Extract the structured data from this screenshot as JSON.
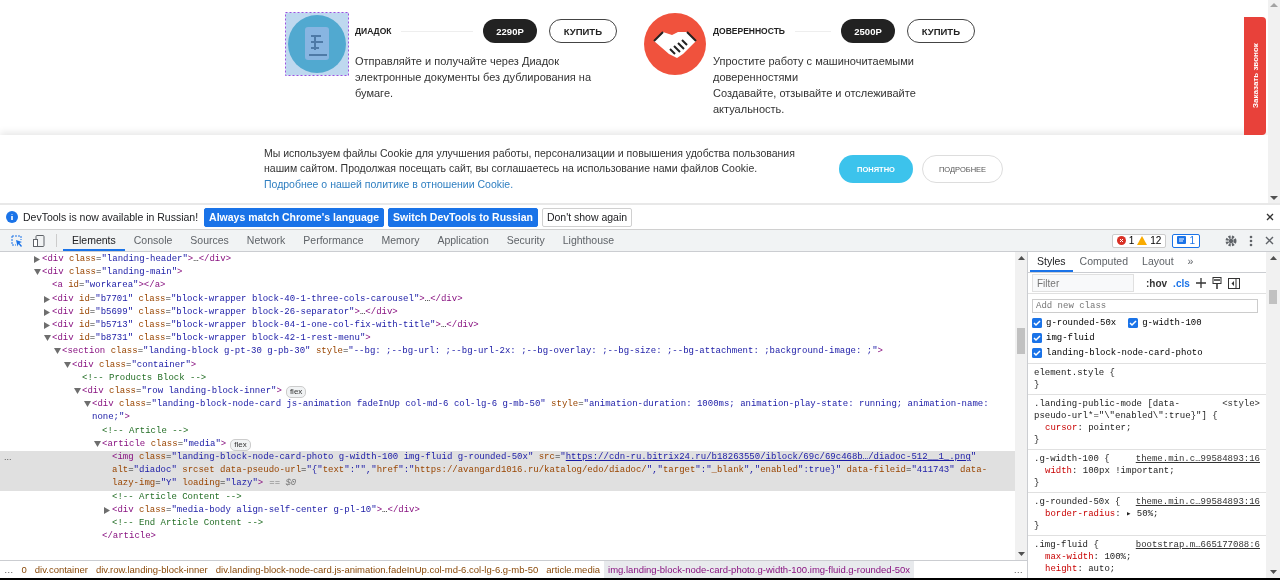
{
  "site": {
    "products": [
      {
        "kind": "document",
        "highlighted": true,
        "title": "ДИАДОК",
        "price": "2290Р",
        "buy_button": "КУПИТЬ",
        "description": [
          "Отправляйте и получайте через Диадок электронные документы без дублирования на бумаге."
        ]
      },
      {
        "kind": "handshake",
        "highlighted": false,
        "title": "ДОВЕРЕННОСТЬ",
        "price": "2500Р",
        "buy_button": "КУПИТЬ",
        "description": [
          "Упростите работу с машиночитаемыми доверенностями",
          "Создавайте, отзывайте и отслеживайте актуальность."
        ]
      }
    ],
    "callback_tab": "Заказать звонок",
    "cookie_banner": {
      "text": "Мы используем файлы Cookie для улучшения работы, персонализации и повышения удобства пользования нашим сайтом. Продолжая посещать сайт, вы соглашаетесь на использование нами файлов Cookie.",
      "link": "Подробнее о нашей политике в отношении Cookie.",
      "accept_button": "ПОНЯТНО",
      "more_button": "ПОДРОБНЕЕ"
    }
  },
  "devtools": {
    "infobar": {
      "message": "DevTools is now available in Russian!",
      "buttons": [
        {
          "label": "Always match Chrome's language",
          "kind": "primary"
        },
        {
          "label": "Switch DevTools to Russian",
          "kind": "primary"
        },
        {
          "label": "Don't show again",
          "kind": "secondary"
        }
      ]
    },
    "tabs": [
      {
        "label": "Elements",
        "selected": true
      },
      {
        "label": "Console",
        "selected": false
      },
      {
        "label": "Sources",
        "selected": false
      },
      {
        "label": "Network",
        "selected": false
      },
      {
        "label": "Performance",
        "selected": false
      },
      {
        "label": "Memory",
        "selected": false
      },
      {
        "label": "Application",
        "selected": false
      },
      {
        "label": "Security",
        "selected": false
      },
      {
        "label": "Lighthouse",
        "selected": false
      }
    ],
    "issues": {
      "errors": "1",
      "warnings": "12",
      "messages": "1"
    },
    "dom_tree": [
      {
        "kind": "element",
        "text": "<div class=\"landing-header\">…</div>",
        "expanded": false,
        "selected": false
      },
      {
        "kind": "element",
        "text": "<div class=\"landing-main\">",
        "expanded": true,
        "selected": false,
        "children": [
          {
            "kind": "leaf",
            "text": "<a id=\"workarea\"></a>",
            "selected": false
          },
          {
            "kind": "element",
            "text": "<div id=\"b7701\" class=\"block-wrapper block-40-1-three-cols-carousel\">…</div>",
            "expanded": false,
            "selected": false
          },
          {
            "kind": "element",
            "text": "<div id=\"b5699\" class=\"block-wrapper block-26-separator\">…</div>",
            "expanded": false,
            "selected": false
          },
          {
            "kind": "element",
            "text": "<div id=\"b5713\" class=\"block-wrapper block-04-1-one-col-fix-with-title\">…</div>",
            "expanded": false,
            "selected": false
          },
          {
            "kind": "element",
            "text": "<div id=\"b8731\" class=\"block-wrapper block-42-1-rest-menu\">",
            "expanded": true,
            "selected": false,
            "children": [
              {
                "kind": "element",
                "text": "<section class=\"landing-block g-pt-30 g-pb-30\" style=\"--bg: ;--bg-url: ;--bg-url-2x: ;--bg-overlay: ;--bg-size: ;--bg-attachment: ;background-image: ;\">",
                "expanded": true,
                "selected": false,
                "children": [
                  {
                    "kind": "element",
                    "text": "<div class=\"container\">",
                    "expanded": true,
                    "selected": false,
                    "children": [
                      {
                        "kind": "comment",
                        "text": "<!-- Products Block -->",
                        "selected": false
                      },
                      {
                        "kind": "element",
                        "text": "<div class=\"row landing-block-inner\">",
                        "badge": "flex",
                        "expanded": true,
                        "selected": false,
                        "children": [
                          {
                            "kind": "element",
                            "text": "<div class=\"landing-block-node-card js-animation fadeInUp col-md-6 col-lg-6 g-mb-50\" style=\"animation-duration: 1000ms; animation-play-state: running; animation-name: none;\">",
                            "expanded": true,
                            "selected": false,
                            "children": [
                              {
                                "kind": "comment",
                                "text": "<!-- Article -->",
                                "selected": false
                              },
                              {
                                "kind": "element",
                                "text": "<article class=\"media\">",
                                "badge": "flex",
                                "expanded": true,
                                "selected": false,
                                "closing": "</article>",
                                "children": [
                                  {
                                    "kind": "leaf",
                                    "dots": "...",
                                    "text": "<img class=\"landing-block-node-card-photo g-width-100 img-fluid g-rounded-50x\" src=\"",
                                    "link": "https://cdn-ru.bitrix24.ru/b18263550/iblock/69c/69c468b…/diadoc-512__1_.png",
                                    "after": "\" alt=\"diadoc\" srcset data-pseudo-url=\"{\"text\":\"\",\"href\":\"https://avangard1016.ru/katalog/edo/diadoc/\",\"target\":\"_blank\",\"enabled\":true}\" data-fileid=\"411743\" data-lazy-img=\"Y\" loading=\"lazy\">",
                                    "suffix": "== $0",
                                    "selected": true
                                  },
                                  {
                                    "kind": "comment",
                                    "text": "<!-- Article Content -->",
                                    "selected": false
                                  },
                                  {
                                    "kind": "element",
                                    "text": "<div class=\"media-body align-self-center g-pl-10\">…</div>",
                                    "expanded": false,
                                    "selected": false
                                  },
                                  {
                                    "kind": "comment",
                                    "text": "<!-- End Article Content -->",
                                    "selected": false
                                  }
                                ]
                              }
                            ]
                          }
                        ]
                      }
                    ]
                  }
                ]
              }
            ]
          }
        ]
      }
    ],
    "styles": {
      "tabs": [
        {
          "label": "Styles",
          "selected": true
        },
        {
          "label": "Computed",
          "selected": false
        },
        {
          "label": "Layout",
          "selected": false
        }
      ],
      "more": "»",
      "filter_placeholder": "Filter",
      "hov": ":hov",
      "cls": ".cls",
      "class_placeholder": "Add new class",
      "classes": [
        {
          "name": "g-rounded-50x",
          "checked": true
        },
        {
          "name": "g-width-100",
          "checked": true
        },
        {
          "name": "img-fluid",
          "checked": true
        },
        {
          "name": "landing-block-node-card-photo",
          "checked": true
        }
      ],
      "rules": [
        {
          "selector": "element.style {",
          "close": "}"
        },
        {
          "selector": ".landing-public-mode [data-pseudo-url*=\"\\\"enabled\\\":true}\"] {",
          "source": "<style>",
          "source_linked": false,
          "properties": [
            {
              "name": "cursor",
              "value": ": pointer;"
            }
          ],
          "close": "}"
        },
        {
          "selector": ".g-width-100 {",
          "source": "theme.min.c…99584893:16",
          "source_linked": true,
          "properties": [
            {
              "name": "width",
              "value": ": 100px !important;"
            }
          ],
          "close": "}"
        },
        {
          "selector": ".g-rounded-50x {",
          "source": "theme.min.c…99584893:16",
          "source_linked": true,
          "properties": [
            {
              "name": "border-radius",
              "value": ": ▸ 50%;"
            }
          ],
          "close": "}"
        },
        {
          "selector": ".img-fluid {",
          "source": "bootstrap.m…665177088:6",
          "source_linked": true,
          "properties": [
            {
              "name": "max-width",
              "value": ": 100%;"
            },
            {
              "name": "height",
              "value": ": auto;"
            }
          ]
        }
      ]
    },
    "breadcrumbs": {
      "left": "…",
      "right": "…",
      "items": [
        {
          "label": "0",
          "selected": false
        },
        {
          "label": "div.container",
          "selected": false
        },
        {
          "label": "div.row.landing-block-inner",
          "selected": false
        },
        {
          "label": "div.landing-block-node-card.js-animation.fadeInUp.col-md-6.col-lg-6.g-mb-50",
          "selected": false
        },
        {
          "label": "article.media",
          "selected": false
        },
        {
          "label": "img.landing-block-node-card-photo.g-width-100.img-fluid.g-rounded-50x",
          "selected": true
        }
      ]
    }
  }
}
